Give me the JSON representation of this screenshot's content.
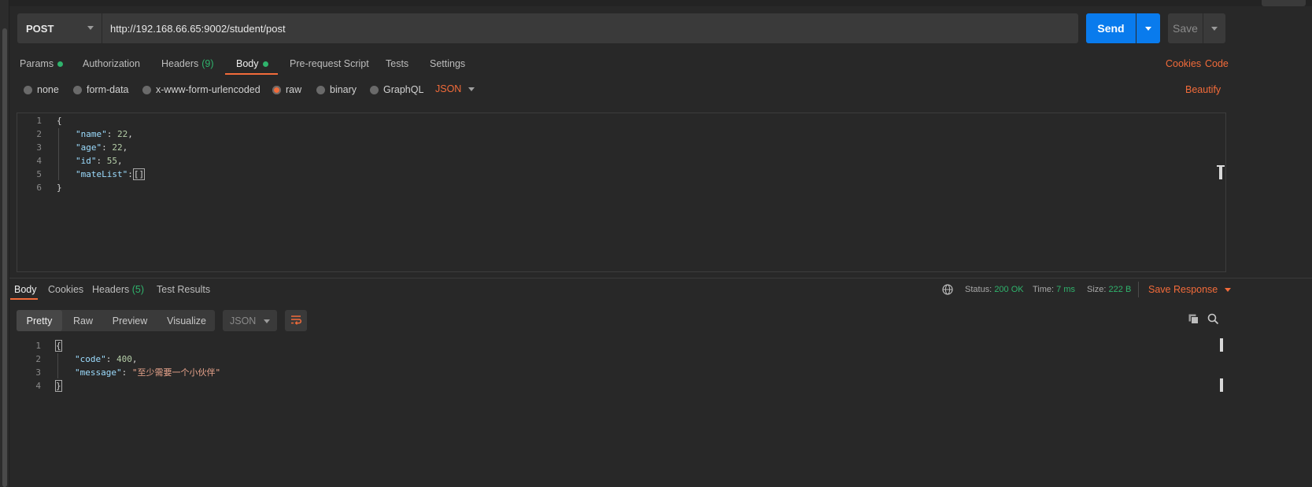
{
  "request": {
    "method": "POST",
    "url": "http://192.168.66.65:9002/student/post",
    "send_label": "Send",
    "save_label": "Save"
  },
  "request_tabs": {
    "params": "Params",
    "authorization": "Authorization",
    "headers": "Headers",
    "headers_count": "(9)",
    "body": "Body",
    "prerequest": "Pre-request Script",
    "tests": "Tests",
    "settings": "Settings",
    "cookies": "Cookies",
    "code": "Code"
  },
  "body_types": {
    "none": "none",
    "form_data": "form-data",
    "urlencoded": "x-www-form-urlencoded",
    "raw": "raw",
    "binary": "binary",
    "graphql": "GraphQL",
    "format": "JSON",
    "beautify": "Beautify"
  },
  "request_body": {
    "line_numbers": [
      "1",
      "2",
      "3",
      "4",
      "5",
      "6"
    ],
    "open_brace": "{",
    "close_brace": "}",
    "k1": "\"name\"",
    "v1": "22",
    "k2": "\"age\"",
    "v2": "22",
    "k3": "\"id\"",
    "v3": "55",
    "k4": "\"mateList\"",
    "v4": "[]"
  },
  "response_tabs": {
    "body": "Body",
    "cookies": "Cookies",
    "headers": "Headers",
    "headers_count": "(5)",
    "test_results": "Test Results"
  },
  "response_meta": {
    "status_label": "Status:",
    "status_value": "200 OK",
    "time_label": "Time:",
    "time_value": "7 ms",
    "size_label": "Size:",
    "size_value": "222 B",
    "save_response": "Save Response"
  },
  "response_view": {
    "pretty": "Pretty",
    "raw": "Raw",
    "preview": "Preview",
    "visualize": "Visualize",
    "format": "JSON"
  },
  "response_body": {
    "line_numbers": [
      "1",
      "2",
      "3",
      "4"
    ],
    "open_brace": "{",
    "close_brace": "}",
    "k1": "\"code\"",
    "v1": "400",
    "k2": "\"message\"",
    "v2": "\"至少需要一个小伙伴\""
  },
  "colors": {
    "accent": "#f26b3a",
    "send_blue": "#097bed",
    "success_green": "#2fb36c",
    "background": "#282828"
  }
}
